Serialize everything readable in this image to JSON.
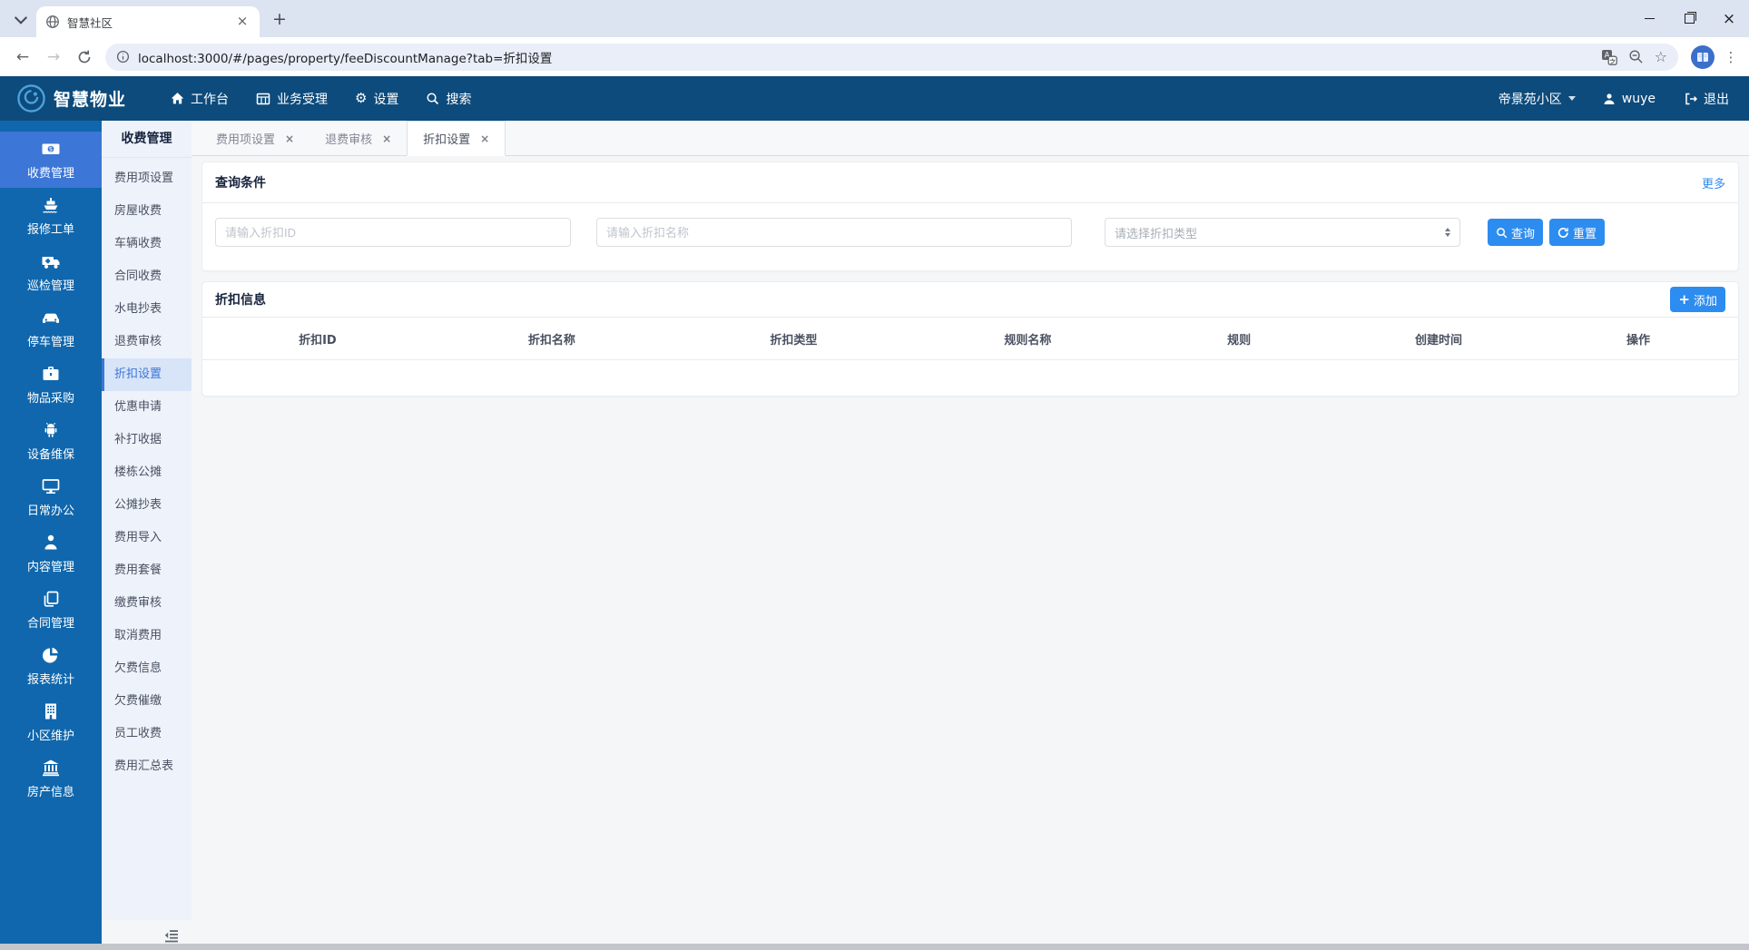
{
  "browser": {
    "tab_title": "智慧社区",
    "url": "localhost:3000/#/pages/property/feeDiscountManage?tab=折扣设置"
  },
  "glyphs": {
    "close": "×",
    "new_tab": "+",
    "back": "←",
    "forward": "→",
    "star": "☆",
    "menu_dots": "⋮",
    "gear": "⚙",
    "plus": "+"
  },
  "topnav": {
    "brand": "智慧物业",
    "items": [
      {
        "label": "工作台",
        "icon": "home-icon"
      },
      {
        "label": "业务受理",
        "icon": "grid-icon"
      },
      {
        "label": "设置",
        "icon": "gear-icon"
      },
      {
        "label": "搜索",
        "icon": "search-icon"
      }
    ],
    "community": "帝景苑小区",
    "username": "wuye",
    "logout": "退出"
  },
  "sidebar": {
    "items": [
      {
        "label": "收费管理",
        "icon": "money-icon",
        "active": true
      },
      {
        "label": "报修工单",
        "icon": "ship-icon"
      },
      {
        "label": "巡检管理",
        "icon": "truck-icon"
      },
      {
        "label": "停车管理",
        "icon": "car-icon"
      },
      {
        "label": "物品采购",
        "icon": "briefcase-icon"
      },
      {
        "label": "设备维保",
        "icon": "android-icon"
      },
      {
        "label": "日常办公",
        "icon": "desktop-icon"
      },
      {
        "label": "内容管理",
        "icon": "person-icon"
      },
      {
        "label": "合同管理",
        "icon": "copy-icon"
      },
      {
        "label": "报表统计",
        "icon": "pie-chart-icon"
      },
      {
        "label": "小区维护",
        "icon": "building-icon"
      },
      {
        "label": "房产信息",
        "icon": "bank-icon"
      }
    ]
  },
  "submenu": {
    "title": "收费管理",
    "active": "折扣设置",
    "items": [
      "费用项设置",
      "房屋收费",
      "车辆收费",
      "合同收费",
      "水电抄表",
      "退费审核",
      "折扣设置",
      "优惠申请",
      "补打收据",
      "楼栋公摊",
      "公摊抄表",
      "费用导入",
      "费用套餐",
      "缴费审核",
      "取消费用",
      "欠费信息",
      "欠费催缴",
      "员工收费",
      "费用汇总表"
    ]
  },
  "page_tabs": [
    {
      "label": "费用项设置",
      "active": false
    },
    {
      "label": "退费审核",
      "active": false
    },
    {
      "label": "折扣设置",
      "active": true
    }
  ],
  "query": {
    "title": "查询条件",
    "more": "更多",
    "discount_id_placeholder": "请输入折扣ID",
    "discount_name_placeholder": "请输入折扣名称",
    "discount_type_placeholder": "请选择折扣类型",
    "search": "查询",
    "reset": "重置"
  },
  "discounts": {
    "title": "折扣信息",
    "add_label": "添加",
    "columns": [
      "折扣ID",
      "折扣名称",
      "折扣类型",
      "规则名称",
      "规则",
      "创建时间",
      "操作"
    ],
    "rows": []
  },
  "colors": {
    "primary": "#2d8cf0",
    "navbar": "#0d4b7c",
    "sidebar": "#1067ad",
    "sidebar_active": "#3c76d6"
  }
}
